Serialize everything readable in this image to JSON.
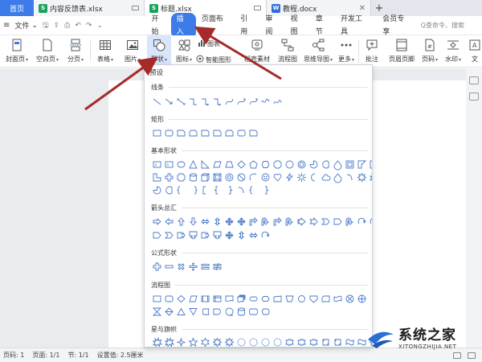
{
  "tabs": {
    "home": "首页",
    "t1": "内容反馈表.xlsx",
    "t2": "标题.xlsx",
    "t3": "教程.docx",
    "add": "+"
  },
  "menubar": {
    "file": "文件",
    "tabs": [
      "开始",
      "插入",
      "页面布局",
      "引用",
      "审阅",
      "视图",
      "章节",
      "开发工具",
      "会员专享"
    ],
    "active_tab": "插入",
    "search_placeholder": "Q查命令、搜索"
  },
  "ribbon": {
    "cover": "封面页",
    "blank": "空白页",
    "break": "分页",
    "table": "表格",
    "picture": "图片",
    "shape": "形状",
    "icon": "图标",
    "smartart": "智能图形",
    "chart_small": "图表",
    "material": "稻壳素材",
    "flowchart": "流程图",
    "mindmap": "思维导图",
    "more": "更多",
    "comment": "批注",
    "headerfooter": "页眉页脚",
    "pagenum": "页码",
    "watermark": "水印",
    "text": "文"
  },
  "dropdown": {
    "header": "预设",
    "sections": [
      "线条",
      "矩形",
      "基本形状",
      "箭头总汇",
      "公式形状",
      "流程图",
      "星与旗帜"
    ]
  },
  "status": {
    "page": "页码: 1",
    "pages": "页面: 1/1",
    "section": "节: 1/1",
    "setting": "设置值: 2.5厘米"
  },
  "watermark": {
    "cn": "系统之家",
    "en": "XITONGZHIJIA.NET"
  },
  "colors": {
    "accent": "#3d7ce8",
    "arrow": "#a52a2a",
    "shape_stroke": "#4a78c8"
  }
}
